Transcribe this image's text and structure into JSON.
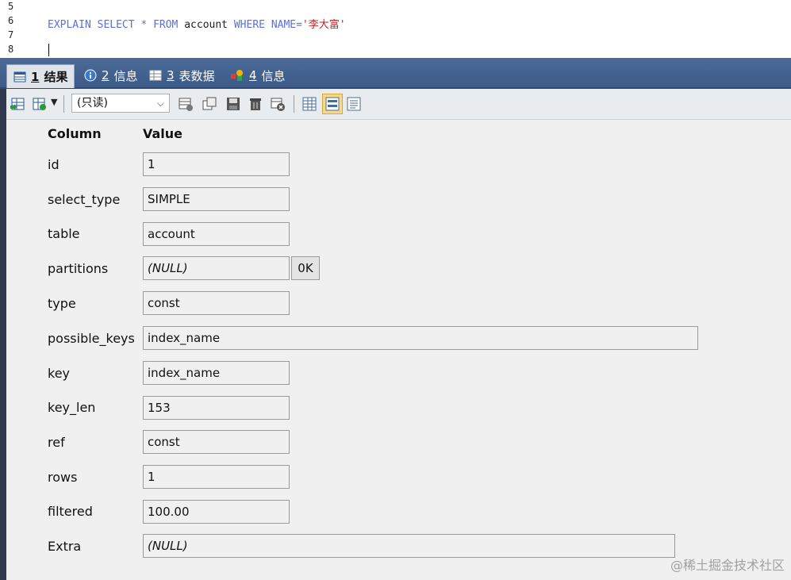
{
  "editor": {
    "line_numbers": [
      "5",
      "6",
      "7",
      "8"
    ],
    "code": {
      "explain": "EXPLAIN",
      "select": "SELECT",
      "star": "*",
      "from": "FROM",
      "table": "account",
      "where": "WHERE",
      "col": "NAME",
      "eq": "=",
      "value": "'李大富'"
    }
  },
  "tabs": [
    {
      "num": "1",
      "label": "结果"
    },
    {
      "num": "2",
      "label": "信息"
    },
    {
      "num": "3",
      "label": "表数据"
    },
    {
      "num": "4",
      "label": "信息"
    }
  ],
  "toolbar": {
    "mode_select": "(只读)",
    "icons": [
      "export-icon",
      "import-icon",
      "insert-row-icon",
      "duplicate-row-icon",
      "save-icon",
      "delete-icon",
      "cancel-icon",
      "grid-view-icon",
      "form-view-icon",
      "text-view-icon"
    ]
  },
  "form": {
    "column_header": "Column",
    "value_header": "Value",
    "rows": [
      {
        "label": "id",
        "value": "1"
      },
      {
        "label": "select_type",
        "value": "SIMPLE"
      },
      {
        "label": "table",
        "value": "account"
      },
      {
        "label": "partitions",
        "value": "(NULL)",
        "button": "0K"
      },
      {
        "label": "type",
        "value": "const"
      },
      {
        "label": "possible_keys",
        "value": "index_name"
      },
      {
        "label": "key",
        "value": "index_name"
      },
      {
        "label": "key_len",
        "value": "153"
      },
      {
        "label": "ref",
        "value": "const"
      },
      {
        "label": "rows",
        "value": "1"
      },
      {
        "label": "filtered",
        "value": "100.00"
      },
      {
        "label": "Extra",
        "value": "(NULL)"
      }
    ]
  },
  "watermark": "@稀土掘金技术社区"
}
